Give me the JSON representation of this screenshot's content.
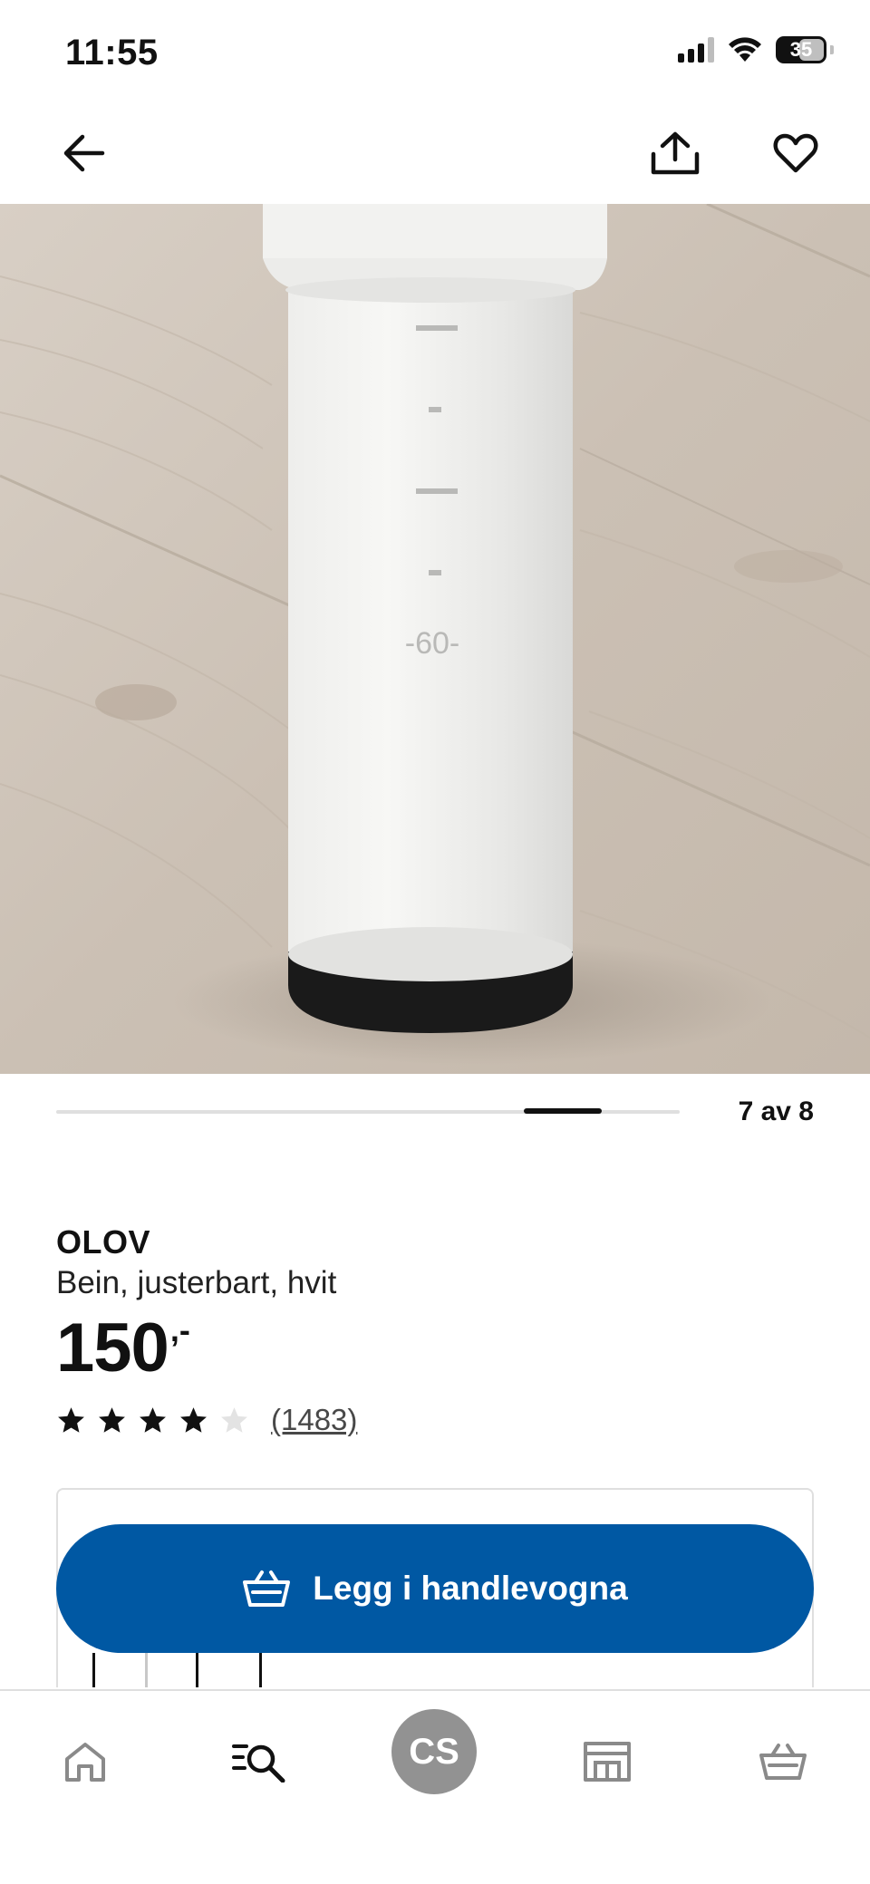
{
  "status_bar": {
    "time": "11:55",
    "battery": "35",
    "icons": [
      "cellular-signal-icon",
      "wifi-icon",
      "battery-icon"
    ]
  },
  "app_bar": {
    "icons": [
      "back-arrow-icon",
      "share-icon",
      "heart-icon"
    ]
  },
  "product_image": {
    "scale_marking": "-60-"
  },
  "carousel": {
    "counter": "7 av 8",
    "current": 7,
    "total": 8
  },
  "product": {
    "name": "OLOV",
    "description": "Bein, justerbart, hvit",
    "price": "150",
    "price_suffix": ",-",
    "rating": 4,
    "rating_max": 5,
    "review_count": "(1483)"
  },
  "cta": {
    "label": "Legg i handlevogna",
    "icon": "basket-icon",
    "color": "#0058a3"
  },
  "bottom_nav": {
    "items": [
      {
        "name": "home",
        "icon": "home-icon"
      },
      {
        "name": "search",
        "icon": "search-icon"
      },
      {
        "name": "profile",
        "label": "CS"
      },
      {
        "name": "store",
        "icon": "store-icon"
      },
      {
        "name": "cart",
        "icon": "cart-icon"
      }
    ]
  }
}
